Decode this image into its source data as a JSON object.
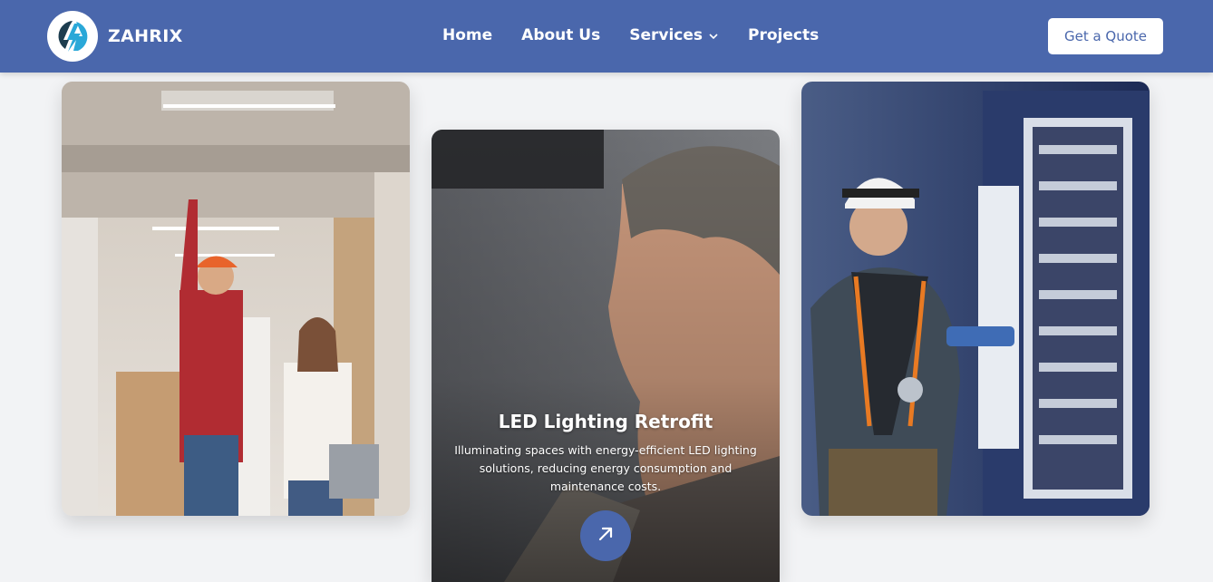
{
  "brand": {
    "name": "ZAHRIX",
    "logo_icon": "lightning-bolt-icon",
    "accent_color": "#4a67ac"
  },
  "nav": {
    "items": [
      {
        "label": "Home"
      },
      {
        "label": "About Us"
      },
      {
        "label": "Services",
        "icon": "chevron-down-icon"
      },
      {
        "label": "Projects"
      }
    ],
    "cta_label": "Get a Quote"
  },
  "cards": [
    {
      "image": "engineers-pointing-at-ceiling-photo"
    },
    {
      "image": "man-looking-up-photo",
      "title": "LED Lighting Retrofit",
      "description": "Illuminating spaces with energy-efficient LED lighting solutions, reducing energy consumption and maintenance costs.",
      "button_icon": "arrow-up-right-icon"
    },
    {
      "image": "electrician-at-switchboard-photo"
    }
  ]
}
